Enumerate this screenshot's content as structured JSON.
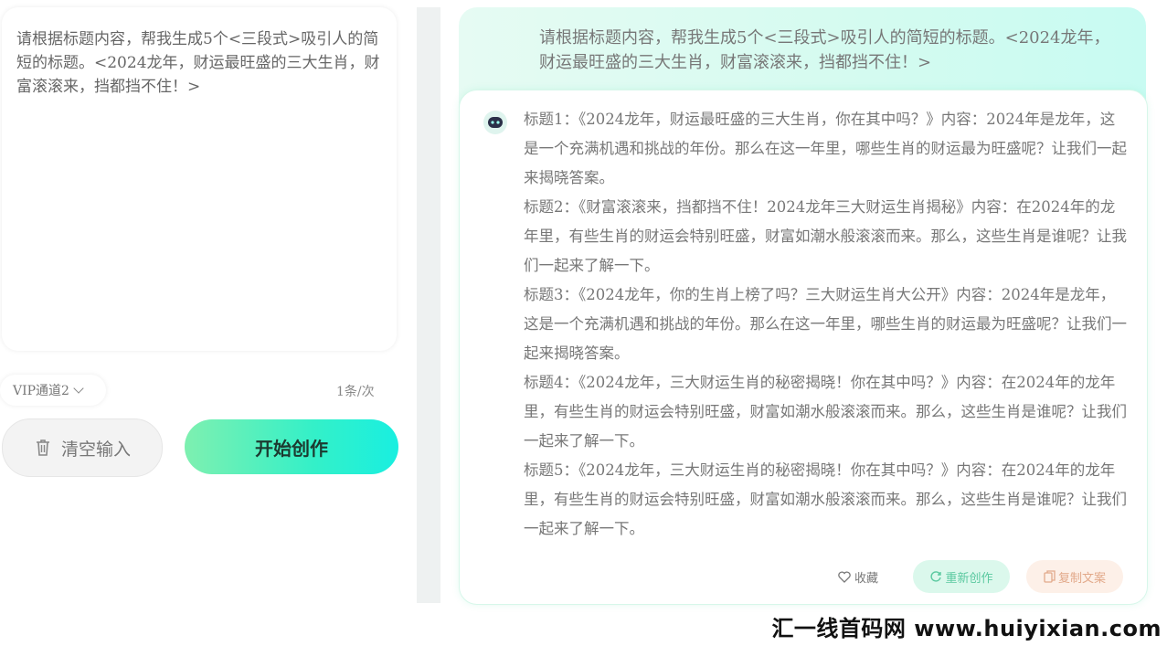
{
  "left": {
    "prompt_text": "请根据标题内容，帮我生成5个<三段式>吸引人的简短的标题。<2024龙年，财运最旺盛的三大生肖，财富滚滚来，挡都挡不住！>",
    "channel_label": "VIP通道2",
    "quota_text": "1条/次",
    "clear_label": "清空输入",
    "start_label": "开始创作"
  },
  "right": {
    "user_message": "请根据标题内容，帮我生成5个<三段式>吸引人的简短的标题。<2024龙年，财运最旺盛的三大生肖，财富滚滚来，挡都挡不住！>",
    "answer_paragraphs": [
      "标题1：《2024龙年，财运最旺盛的三大生肖，你在其中吗？》内容：2024年是龙年，这是一个充满机遇和挑战的年份。那么在这一年里，哪些生肖的财运最为旺盛呢？让我们一起来揭晓答案。",
      "标题2：《财富滚滚来，挡都挡不住！2024龙年三大财运生肖揭秘》内容：在2024年的龙年里，有些生肖的财运会特别旺盛，财富如潮水般滚滚而来。那么，这些生肖是谁呢？让我们一起来了解一下。",
      "标题3：《2024龙年，你的生肖上榜了吗？三大财运生肖大公开》内容：2024年是龙年，这是一个充满机遇和挑战的年份。那么在这一年里，哪些生肖的财运最为旺盛呢？让我们一起来揭晓答案。",
      "标题4：《2024龙年，三大财运生肖的秘密揭晓！你在其中吗？》内容：在2024年的龙年里，有些生肖的财运会特别旺盛，财富如潮水般滚滚而来。那么，这些生肖是谁呢？让我们一起来了解一下。",
      "标题5：《2024龙年，三大财运生肖的秘密揭晓！你在其中吗？》内容：在2024年的龙年里，有些生肖的财运会特别旺盛，财富如潮水般滚滚而来。那么，这些生肖是谁呢？让我们一起来了解一下。"
    ],
    "favorite_label": "收藏",
    "regenerate_label": "重新创作",
    "copy_label": "复制文案"
  },
  "watermark": "汇一线首码网 www.huiyixian.com",
  "colors": {
    "accent_green": "#34f0c8",
    "regen_text": "#5bc9a0",
    "copy_text": "#e2a98a"
  },
  "icons": {
    "clear": "trash-icon",
    "bot": "robot-avatar-icon",
    "favorite": "heart-icon",
    "regenerate": "refresh-icon",
    "copy": "copy-icon",
    "channel": "chevron-down-icon"
  }
}
